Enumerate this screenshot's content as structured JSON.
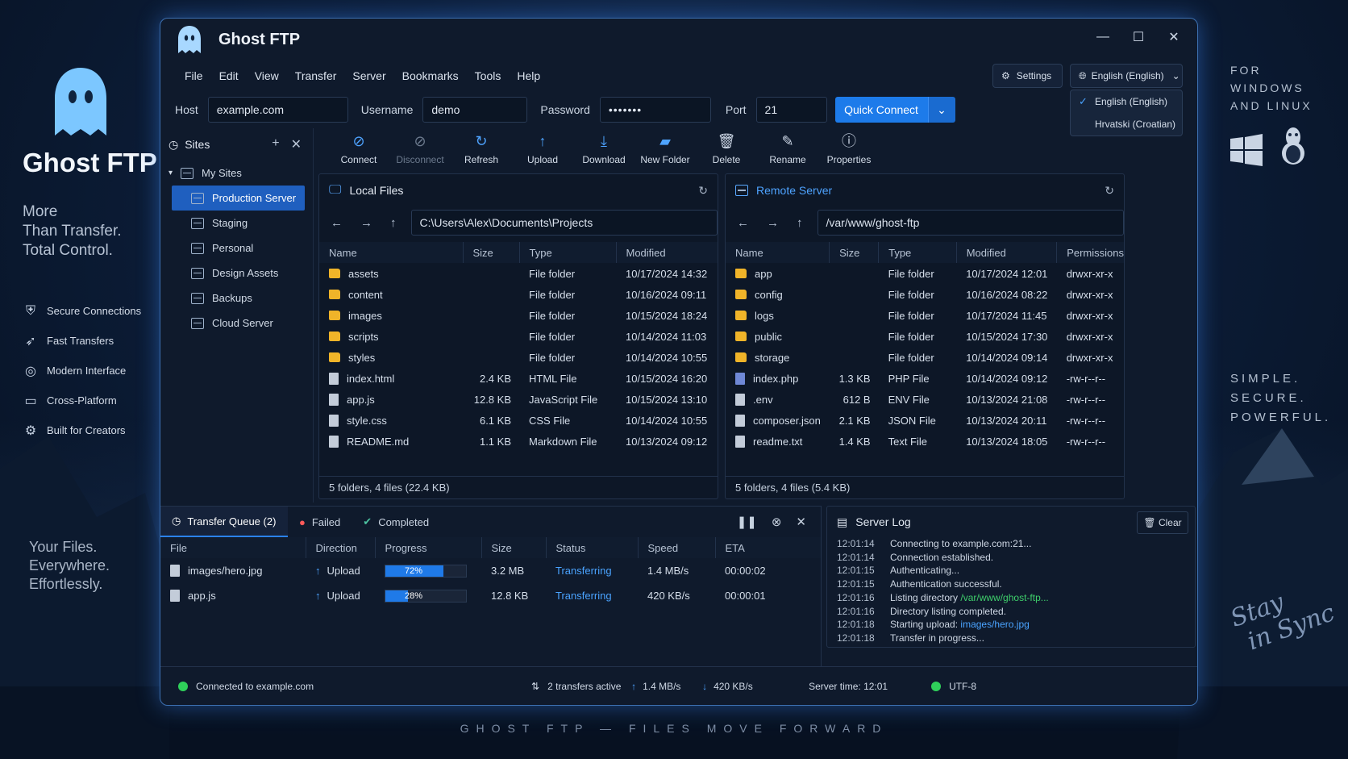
{
  "promo": {
    "brand": "Ghost FTP",
    "tagline": [
      "More",
      "Than Transfer.",
      "Total Control."
    ],
    "features": [
      {
        "icon": "shield-icon",
        "label": "Secure Connections"
      },
      {
        "icon": "rocket-icon",
        "label": "Fast Transfers"
      },
      {
        "icon": "palette-icon",
        "label": "Modern Interface"
      },
      {
        "icon": "monitor-icon",
        "label": "Cross-Platform"
      },
      {
        "icon": "gear-icon",
        "label": "Built for Creators"
      }
    ],
    "tagline2": [
      "Your Files.",
      "Everywhere.",
      "Effortlessly."
    ],
    "for_os": [
      "FOR",
      "WINDOWS",
      "AND LINUX"
    ],
    "simple": [
      "SIMPLE.",
      "SECURE.",
      "POWERFUL."
    ],
    "signature": [
      "Stay",
      "in Sync"
    ],
    "footer": "GHOST FTP — FILES MOVE FORWARD"
  },
  "window": {
    "title": "Ghost FTP",
    "menu": [
      "File",
      "Edit",
      "View",
      "Transfer",
      "Server",
      "Bookmarks",
      "Tools",
      "Help"
    ],
    "settings_label": "Settings",
    "language": {
      "current": "English (English)",
      "options": [
        "English (English)",
        "Hrvatski (Croatian)"
      ]
    }
  },
  "connection": {
    "host_label": "Host",
    "host": "example.com",
    "username_label": "Username",
    "username": "demo",
    "password_label": "Password",
    "password": "•••••••",
    "port_label": "Port",
    "port": "21",
    "quick_connect": "Quick Connect"
  },
  "sites": {
    "title": "Sites",
    "root": "My Sites",
    "items": [
      "Production Server",
      "Staging",
      "Personal",
      "Design Assets",
      "Backups",
      "Cloud Server"
    ],
    "selected": "Production Server"
  },
  "toolbar": [
    {
      "label": "Connect",
      "icon": "connect-icon",
      "enabled": true
    },
    {
      "label": "Disconnect",
      "icon": "disconnect-icon",
      "enabled": false
    },
    {
      "label": "Refresh",
      "icon": "refresh-icon",
      "enabled": true
    },
    {
      "label": "Upload",
      "icon": "upload-icon",
      "enabled": true
    },
    {
      "label": "Download",
      "icon": "download-icon",
      "enabled": true
    },
    {
      "label": "New Folder",
      "icon": "new-folder-icon",
      "enabled": true
    },
    {
      "label": "Delete",
      "icon": "trash-icon",
      "enabled": true
    },
    {
      "label": "Rename",
      "icon": "rename-icon",
      "enabled": true
    },
    {
      "label": "Properties",
      "icon": "info-icon",
      "enabled": true
    }
  ],
  "local": {
    "title": "Local Files",
    "path": "C:\\Users\\Alex\\Documents\\Projects",
    "columns": [
      "Name",
      "Size",
      "Type",
      "Modified"
    ],
    "rows": [
      {
        "kind": "folder",
        "name": "assets",
        "size": "",
        "type": "File folder",
        "modified": "10/17/2024 14:32"
      },
      {
        "kind": "folder",
        "name": "content",
        "size": "",
        "type": "File folder",
        "modified": "10/16/2024 09:11"
      },
      {
        "kind": "folder",
        "name": "images",
        "size": "",
        "type": "File folder",
        "modified": "10/15/2024 18:24"
      },
      {
        "kind": "folder",
        "name": "scripts",
        "size": "",
        "type": "File folder",
        "modified": "10/14/2024 11:03"
      },
      {
        "kind": "folder",
        "name": "styles",
        "size": "",
        "type": "File folder",
        "modified": "10/14/2024 10:55"
      },
      {
        "kind": "file",
        "name": "index.html",
        "size": "2.4 KB",
        "type": "HTML File",
        "modified": "10/15/2024 16:20"
      },
      {
        "kind": "file",
        "name": "app.js",
        "size": "12.8 KB",
        "type": "JavaScript File",
        "modified": "10/15/2024 13:10"
      },
      {
        "kind": "file",
        "name": "style.css",
        "size": "6.1 KB",
        "type": "CSS File",
        "modified": "10/14/2024 10:55"
      },
      {
        "kind": "file",
        "name": "README.md",
        "size": "1.1 KB",
        "type": "Markdown File",
        "modified": "10/13/2024 09:12"
      }
    ],
    "footer": "5 folders, 4 files (22.4 KB)"
  },
  "remote": {
    "title": "Remote Server",
    "path": "/var/www/ghost-ftp",
    "columns": [
      "Name",
      "Size",
      "Type",
      "Modified",
      "Permissions"
    ],
    "rows": [
      {
        "kind": "folder",
        "name": "app",
        "size": "",
        "type": "File folder",
        "modified": "10/17/2024 12:01",
        "perm": "drwxr-xr-x"
      },
      {
        "kind": "folder",
        "name": "config",
        "size": "",
        "type": "File folder",
        "modified": "10/16/2024 08:22",
        "perm": "drwxr-xr-x"
      },
      {
        "kind": "folder",
        "name": "logs",
        "size": "",
        "type": "File folder",
        "modified": "10/17/2024 11:45",
        "perm": "drwxr-xr-x"
      },
      {
        "kind": "folder",
        "name": "public",
        "size": "",
        "type": "File folder",
        "modified": "10/15/2024 17:30",
        "perm": "drwxr-xr-x"
      },
      {
        "kind": "folder",
        "name": "storage",
        "size": "",
        "type": "File folder",
        "modified": "10/14/2024 09:14",
        "perm": "drwxr-xr-x"
      },
      {
        "kind": "php",
        "name": "index.php",
        "size": "1.3 KB",
        "type": "PHP File",
        "modified": "10/14/2024 09:12",
        "perm": "-rw-r--r--"
      },
      {
        "kind": "file",
        "name": ".env",
        "size": "612 B",
        "type": "ENV File",
        "modified": "10/13/2024 21:08",
        "perm": "-rw-r--r--"
      },
      {
        "kind": "file",
        "name": "composer.json",
        "size": "2.1 KB",
        "type": "JSON File",
        "modified": "10/13/2024 20:11",
        "perm": "-rw-r--r--"
      },
      {
        "kind": "file",
        "name": "readme.txt",
        "size": "1.4 KB",
        "type": "Text File",
        "modified": "10/13/2024 18:05",
        "perm": "-rw-r--r--"
      }
    ],
    "footer": "5 folders, 4 files (5.4 KB)"
  },
  "queue": {
    "tabs": [
      "Transfer Queue (2)",
      "Failed",
      "Completed"
    ],
    "columns": [
      "File",
      "Direction",
      "Progress",
      "Size",
      "Status",
      "Speed",
      "ETA"
    ],
    "rows": [
      {
        "file": "images/hero.jpg",
        "direction": "Upload",
        "progress": 72,
        "progress_label": "72%",
        "size": "3.2 MB",
        "status": "Transferring",
        "speed": "1.4 MB/s",
        "eta": "00:00:02"
      },
      {
        "file": "app.js",
        "direction": "Upload",
        "progress": 28,
        "progress_label": "28%",
        "size": "12.8 KB",
        "status": "Transferring",
        "speed": "420 KB/s",
        "eta": "00:00:01"
      }
    ]
  },
  "log": {
    "title": "Server Log",
    "clear": "Clear",
    "lines": [
      {
        "time": "12:01:14",
        "msg": "Connecting to example.com:21...",
        "hl": ""
      },
      {
        "time": "12:01:14",
        "msg": "Connection established.",
        "hl": ""
      },
      {
        "time": "12:01:15",
        "msg": "Authenticating...",
        "hl": ""
      },
      {
        "time": "12:01:15",
        "msg": "Authentication successful.",
        "hl": ""
      },
      {
        "time": "12:01:16",
        "msg": "Listing directory ",
        "hl": "/var/www/ghost-ftp...",
        "hlcolor": "green"
      },
      {
        "time": "12:01:16",
        "msg": "Directory listing completed.",
        "hl": ""
      },
      {
        "time": "12:01:18",
        "msg": "Starting upload: ",
        "hl": "images/hero.jpg",
        "hlcolor": "blue"
      },
      {
        "time": "12:01:18",
        "msg": "Transfer in progress...",
        "hl": ""
      }
    ]
  },
  "status": {
    "connected": "Connected to example.com",
    "transfers": "2 transfers active",
    "up": "1.4 MB/s",
    "down": "420 KB/s",
    "server_time": "Server time: 12:01",
    "encoding": "UTF-8"
  }
}
